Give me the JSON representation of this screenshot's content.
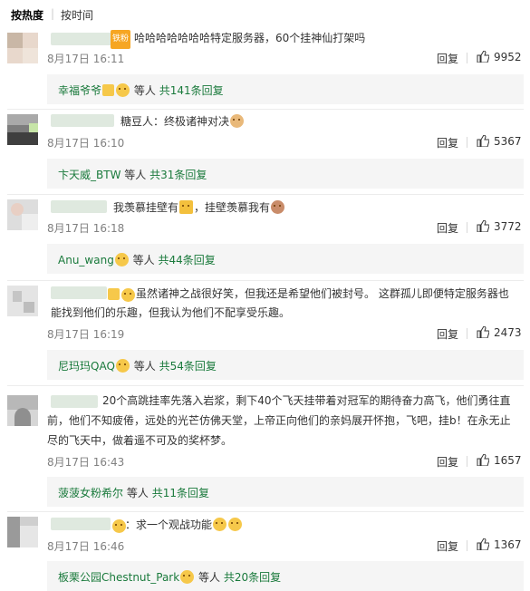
{
  "sort": {
    "hot": "按热度",
    "time": "按时间"
  },
  "actions": {
    "reply": "回复"
  },
  "colors": {
    "reply_link": "#1a7a3c",
    "time": "#808080",
    "reply_bg": "#f5f5f5"
  },
  "comments": [
    {
      "tag": "铁粉",
      "text": "哈哈哈哈哈哈哈特定服务器，60个挂神仙打架吗",
      "time": "8月17日 16:11",
      "likes": "9952",
      "reply_user": "幸福爷爷",
      "reply_deng": "等人",
      "reply_count": "共141条回复"
    },
    {
      "text": "糖豆人：终极诸神对决",
      "time": "8月17日 16:10",
      "likes": "5367",
      "reply_user": "卞天威_BTW",
      "reply_deng": "等人",
      "reply_count": "共31条回复"
    },
    {
      "text": "我羡慕挂壁有",
      "text2": "，挂壁羡慕我有",
      "time": "8月17日 16:18",
      "likes": "3772",
      "reply_user": "Anu_wang",
      "reply_deng": "等人",
      "reply_count": "共44条回复"
    },
    {
      "text_line1": "虽然诸神之战很好笑，但我还是希望他们被封号。 这群孤儿即便特定服务器也",
      "text_line2": "能找到他们的乐趣，但我认为他们不配享受乐趣。",
      "time": "8月17日 16:19",
      "likes": "2473",
      "reply_user": "尼玛玛QAQ",
      "reply_deng": "等人",
      "reply_count": "共54条回复"
    },
    {
      "text_line1": "20个高跳挂率先落入岩浆，剩下40个飞天挂带着对冠军的期待奋力高飞，他们勇往直",
      "text_line2": "前，他们不知疲倦，远处的光芒仿佛天堂，上帝正向他们的亲妈展开怀抱，飞吧，挂b！在永无止",
      "text_line3": "尽的飞天中，做着遥不可及的奖杯梦。",
      "time": "8月17日 16:43",
      "likes": "1657",
      "reply_user": "菠菠女粉希尔",
      "reply_deng": "等人",
      "reply_count": "共11条回复"
    },
    {
      "text": "：求一个观战功能",
      "time": "8月17日 16:46",
      "likes": "1367",
      "reply_user": "板栗公园Chestnut_Park",
      "reply_deng": "等人",
      "reply_count": "共20条回复"
    }
  ]
}
